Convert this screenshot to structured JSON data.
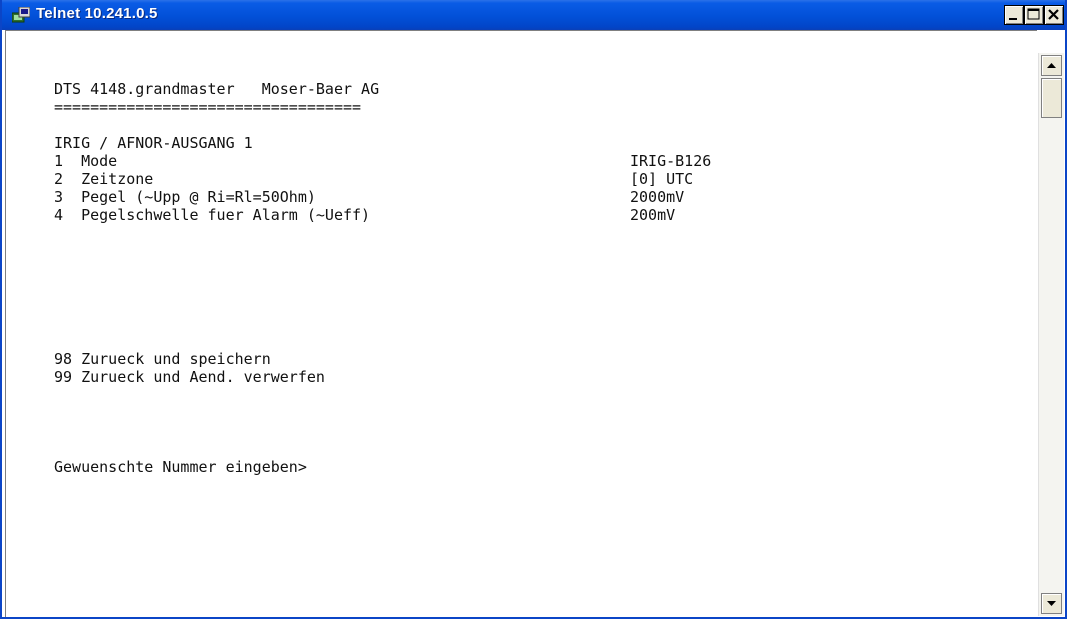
{
  "window": {
    "title": "Telnet 10.241.0.5",
    "buttons": {
      "minimize": "minimize",
      "maximize": "maximize",
      "close": "close"
    }
  },
  "terminal": {
    "header": "DTS 4148.grandmaster   Moser-Baer AG",
    "separator": "==================================",
    "section_title": "IRIG / AFNOR-AUSGANG 1",
    "menu_items": [
      {
        "label": "1  Mode",
        "value": "IRIG-B126"
      },
      {
        "label": "2  Zeitzone",
        "value": "[0] UTC"
      },
      {
        "label": "3  Pegel (~Upp @ Ri=Rl=50Ohm)",
        "value": "2000mV"
      },
      {
        "label": "4  Pegelschwelle fuer Alarm (~Ueff)",
        "value": "200mV"
      }
    ],
    "save_option": "98 Zurueck und speichern",
    "discard_option": "99 Zurueck und Aend. verwerfen",
    "prompt": "Gewuenschte Nummer eingeben>"
  },
  "icons": {
    "app": "terminal-window-icon",
    "scroll_up": "triangle-up-icon",
    "scroll_down": "triangle-down-icon"
  }
}
